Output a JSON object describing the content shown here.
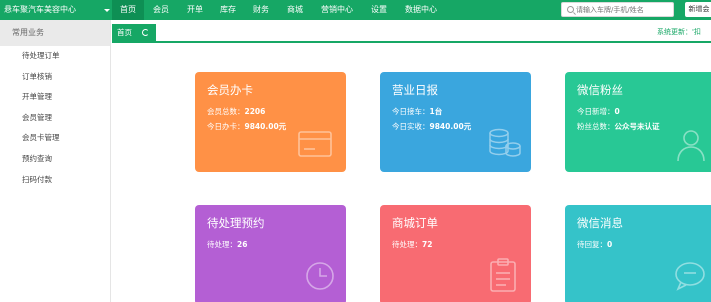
{
  "brand": "悬车聚汽车美容中心",
  "nav": [
    {
      "label": "首页",
      "active": true
    },
    {
      "label": "会员",
      "active": false
    },
    {
      "label": "开单",
      "active": false
    },
    {
      "label": "库存",
      "active": false
    },
    {
      "label": "财务",
      "active": false
    },
    {
      "label": "商城",
      "active": false
    },
    {
      "label": "营销中心",
      "active": false
    },
    {
      "label": "设置",
      "active": false
    },
    {
      "label": "数据中心",
      "active": false
    }
  ],
  "search": {
    "placeholder": "请输入车牌/手机/姓名"
  },
  "new_button": "新增会",
  "sidebar": {
    "header": "常用业务",
    "items": [
      "待处理订单",
      "订单核销",
      "开单管理",
      "会员管理",
      "会员卡管理",
      "预约查询",
      "扫码付款"
    ]
  },
  "tabbar": {
    "home": "首页",
    "system_update": "系统更新：'扣"
  },
  "colors": {
    "brand_green": "#16a765"
  },
  "cards": [
    {
      "title": "会员办卡",
      "color": "#ff9146",
      "icon": "card-icon",
      "lines": [
        {
          "label": "会员总数：",
          "value": "2206"
        },
        {
          "label": "今日办卡：",
          "value": "9840.00元"
        }
      ]
    },
    {
      "title": "营业日报",
      "color": "#3aa6de",
      "icon": "coins-icon",
      "lines": [
        {
          "label": "今日接车：",
          "value": "1台"
        },
        {
          "label": "今日实收：",
          "value": "9840.00元"
        }
      ]
    },
    {
      "title": "微信粉丝",
      "color": "#28c895",
      "icon": "user-icon",
      "lines": [
        {
          "label": "今日新增：",
          "value": "0"
        },
        {
          "label": "粉丝总数：",
          "value": "公众号未认证"
        }
      ]
    },
    {
      "title": "待处理预约",
      "color": "#b45fd4",
      "icon": "clock-icon",
      "lines": [
        {
          "label": "待处理：",
          "value": "26"
        }
      ]
    },
    {
      "title": "商城订单",
      "color": "#f86b72",
      "icon": "clipboard-icon",
      "lines": [
        {
          "label": "待处理：",
          "value": "72"
        }
      ]
    },
    {
      "title": "微信消息",
      "color": "#35c3c9",
      "icon": "chat-bubble-icon",
      "lines": [
        {
          "label": "待回复：",
          "value": "0"
        }
      ]
    }
  ]
}
